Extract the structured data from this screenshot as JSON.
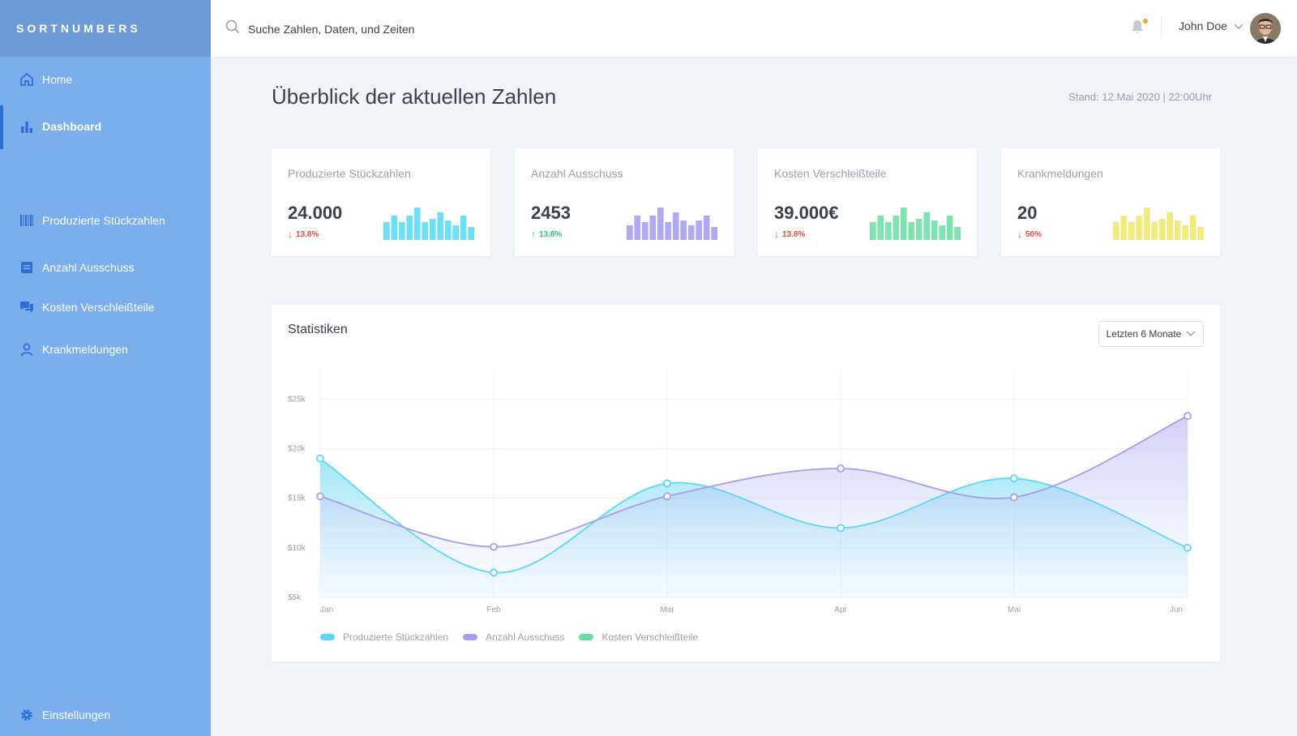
{
  "brand": "SORTNUMBERS",
  "sidebar": {
    "items": [
      {
        "label": "Home",
        "icon": "home-icon"
      },
      {
        "label": "Dashboard",
        "icon": "bar-chart-icon",
        "active": true
      },
      {
        "label": "Produzierte Stückzahlen",
        "icon": "barcode-icon"
      },
      {
        "label": "Anzahl Ausschuss",
        "icon": "list-icon"
      },
      {
        "label": "Kosten Verschleißteile",
        "icon": "chat-icon"
      },
      {
        "label": "Krankmeldungen",
        "icon": "user-icon"
      }
    ],
    "settings": {
      "label": "Einstellungen",
      "icon": "gear-icon"
    }
  },
  "topbar": {
    "search_placeholder": "Suche Zahlen, Daten, und Zeiten",
    "user_name": "John Doe"
  },
  "page": {
    "title": "Überblick der aktuellen Zahlen",
    "stand": "Stand: 12.Mai 2020 | 22:00Uhr"
  },
  "cards": [
    {
      "title": "Produzierte Stückzahlen",
      "value": "24.000",
      "change": "13.8%",
      "direction": "down",
      "color": "#6ee0f5",
      "bars": [
        0.55,
        0.75,
        0.55,
        0.75,
        1.0,
        0.55,
        0.65,
        0.85,
        0.6,
        0.45,
        0.75,
        0.4
      ]
    },
    {
      "title": "Anzahl Ausschuss",
      "value": "2453",
      "change": "13.8%",
      "direction": "up",
      "color": "#b2a9f3",
      "bars": [
        0.45,
        0.75,
        0.55,
        0.75,
        1.0,
        0.55,
        0.85,
        0.6,
        0.45,
        0.6,
        0.75,
        0.4
      ]
    },
    {
      "title": "Kosten Verschleißteile",
      "value": "39.000€",
      "change": "13.8%",
      "direction": "down",
      "color": "#7ee3ae",
      "bars": [
        0.55,
        0.75,
        0.55,
        0.75,
        1.0,
        0.55,
        0.65,
        0.85,
        0.6,
        0.45,
        0.75,
        0.4
      ]
    },
    {
      "title": "Krankmeldungen",
      "value": "20",
      "change": "50%",
      "direction": "down",
      "color": "#f1ea7c",
      "bars": [
        0.55,
        0.75,
        0.55,
        0.75,
        1.0,
        0.55,
        0.65,
        0.85,
        0.6,
        0.45,
        0.75,
        0.4
      ]
    }
  ],
  "stats": {
    "title": "Statistiken",
    "range_label": "Letzten 6 Monate"
  },
  "chart_data": {
    "type": "area",
    "categories": [
      "Jan",
      "Feb",
      "Mar",
      "Apr",
      "Mai",
      "Jun"
    ],
    "y_ticks": [
      "$5k",
      "$10k",
      "$15k",
      "$20k",
      "$25k"
    ],
    "ylim": [
      5000,
      26500
    ],
    "series": [
      {
        "name": "Produzierte Stückzahlen",
        "color": "#5bd8f3",
        "values": [
          19000,
          7500,
          16500,
          12000,
          17000,
          10000
        ]
      },
      {
        "name": "Anzahl Ausschuss",
        "color": "#a99cf0",
        "values": [
          15200,
          10100,
          15200,
          18000,
          15100,
          23300
        ]
      },
      {
        "name": "Kosten Verschleißteile",
        "color": "#63e0a0",
        "values": []
      }
    ],
    "legend_position": "bottom-left",
    "grid": true
  }
}
